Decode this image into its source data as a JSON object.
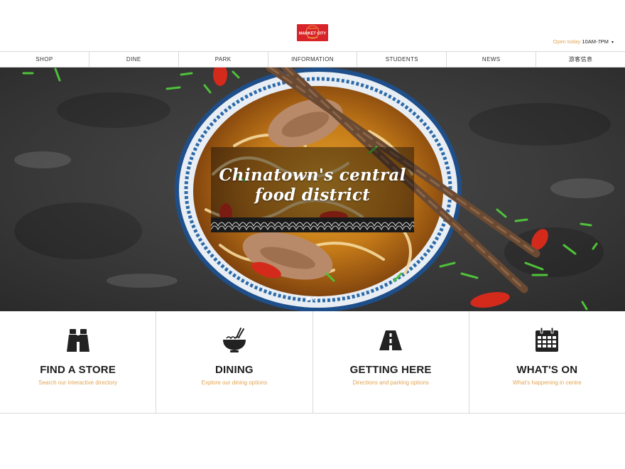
{
  "header": {
    "logo_text": "MARKET CITY",
    "hours_label": "Open today",
    "hours_value": "10AM-7PM",
    "hours_caret": "▾"
  },
  "nav": {
    "items": [
      "SHOP",
      "DINE",
      "PARK",
      "INFORMATION",
      "STUDENTS",
      "NEWS",
      "游客信息"
    ]
  },
  "hero": {
    "title_line1": "Chinatown's central",
    "title_line2": "food district",
    "slides": 2,
    "active_slide": 1
  },
  "features": [
    {
      "icon": "binoculars-icon",
      "title": "FIND A STORE",
      "subtitle": "Search our interactive directory"
    },
    {
      "icon": "noodle-bowl-icon",
      "title": "DINING",
      "subtitle": "Explore our dining options"
    },
    {
      "icon": "road-icon",
      "title": "GETTING HERE",
      "subtitle": "Directions and parking options"
    },
    {
      "icon": "calendar-icon",
      "title": "WHAT'S ON",
      "subtitle": "What's happening in centre"
    }
  ],
  "colors": {
    "accent": "#e2a552",
    "logo_red": "#d8232a",
    "logo_gold": "#f2c14e",
    "text_dark": "#1d1d1d",
    "divider": "#d9d9d9"
  }
}
